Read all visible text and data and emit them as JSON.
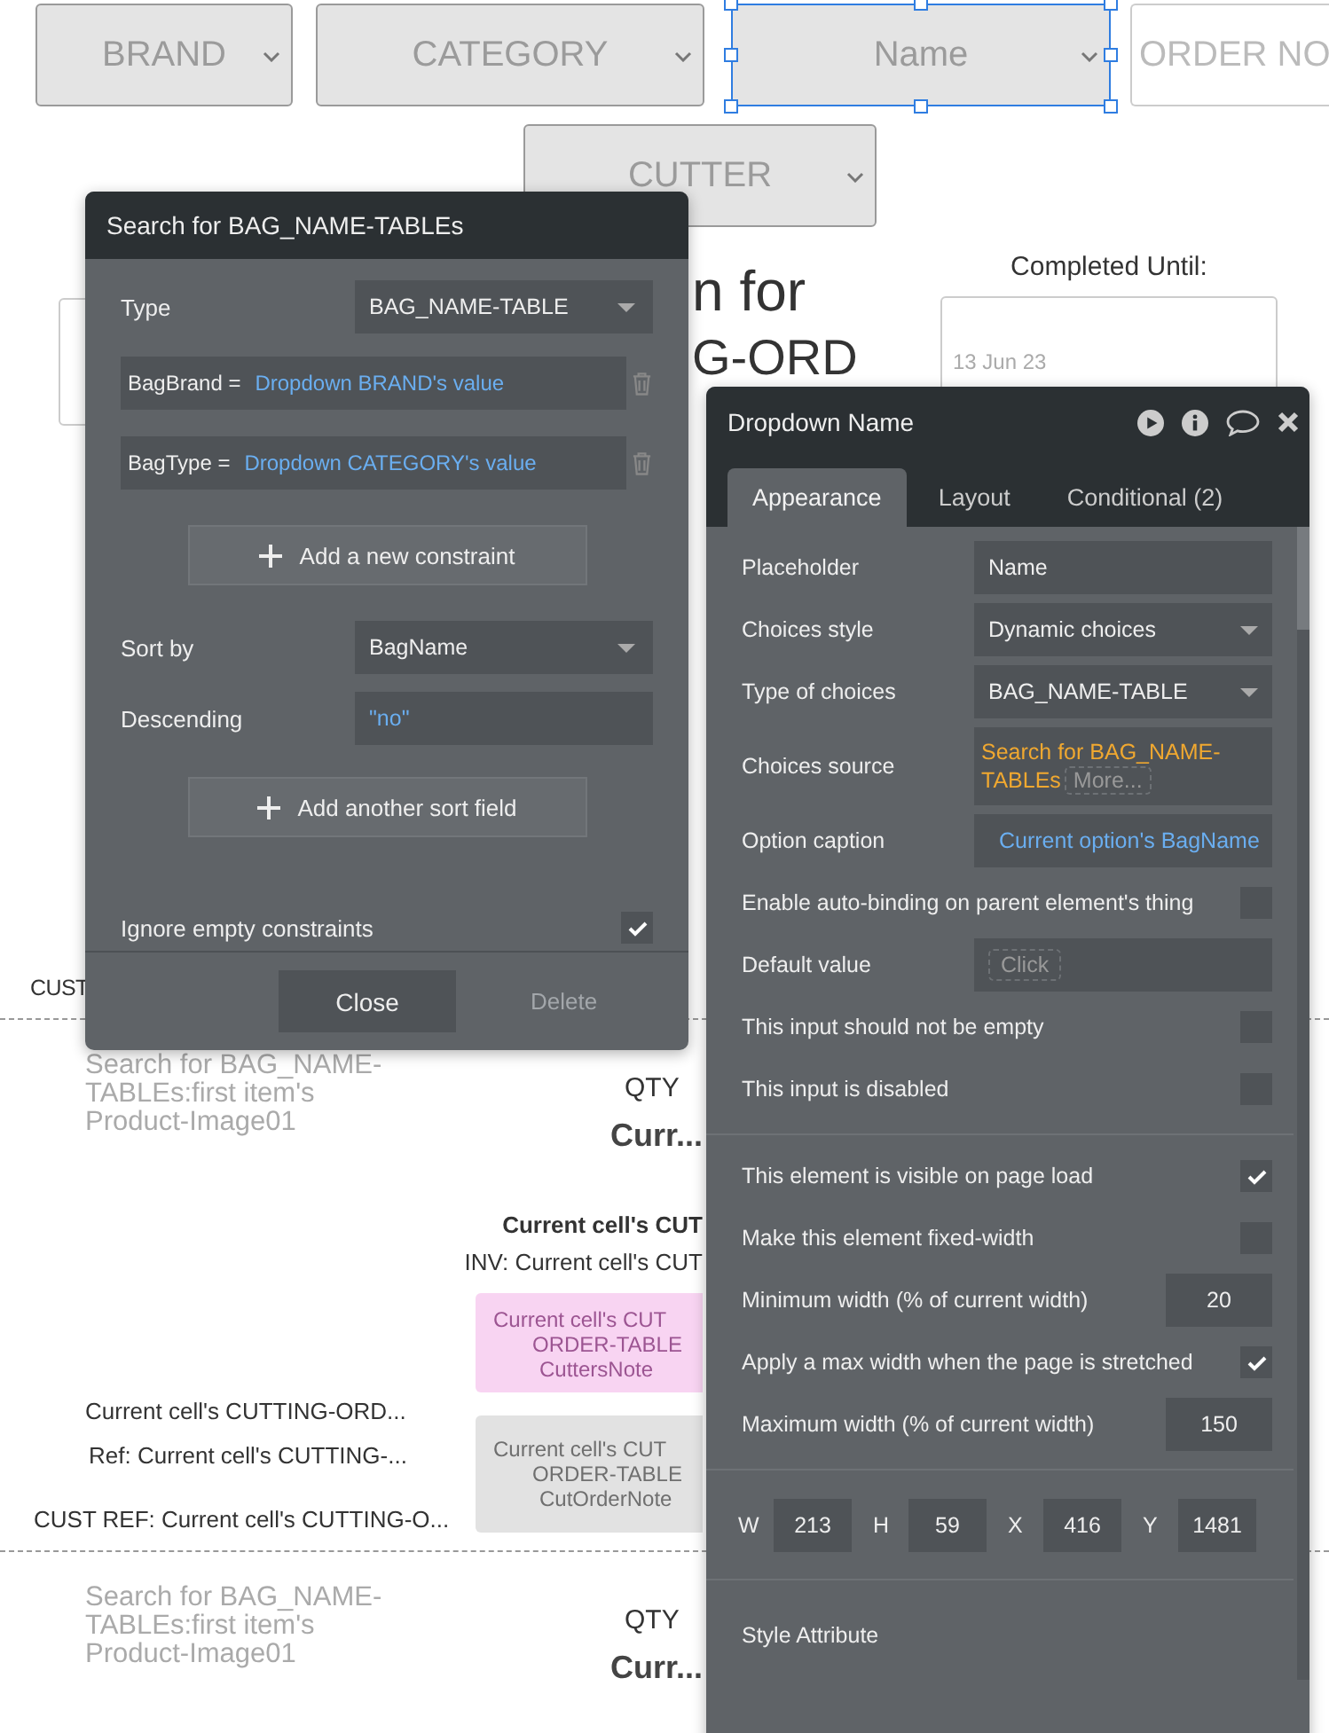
{
  "canvas": {
    "dropdowns": [
      {
        "label": "BRAND",
        "selected": false
      },
      {
        "label": "CATEGORY",
        "selected": false
      },
      {
        "label": "Name",
        "selected": true
      },
      {
        "label": "CUTTER",
        "selected": false
      }
    ],
    "order_no_field": {
      "placeholder": "ORDER NO"
    },
    "heading_fragments": [
      "n for",
      "G-ORD"
    ],
    "completed_until": {
      "label": "Completed Until:",
      "placeholder": "13 Jun 23"
    },
    "cust_label": "CUST",
    "rows": [
      {
        "image_text": "Search for BAG_NAME-TABLEs:first item's Product-Image01",
        "qty_label": "QTY",
        "qty_value": "Curr..."
      },
      {
        "image_text": "Search for BAG_NAME-TABLEs:first item's Product-Image01",
        "qty_label": "QTY",
        "qty_value": "Curr..."
      }
    ],
    "detail": {
      "title": "Current cell's CUT",
      "invoice": "INV: Current cell's CUT",
      "notes": [
        {
          "kind": "cutters",
          "lines": [
            "Current cell's CUT",
            "ORDER-TABLE",
            "CuttersNote"
          ]
        },
        {
          "kind": "order",
          "lines": [
            "Current cell's CUT",
            "ORDER-TABLE",
            "CutOrderNote"
          ]
        }
      ],
      "order_text": "Current cell's CUTTING-ORD...",
      "ref_text": "Ref: Current cell's CUTTING-...",
      "cust_ref_text": "CUST REF: Current cell's CUTTING-O..."
    }
  },
  "search_panel": {
    "title": "Search for BAG_NAME-TABLEs",
    "type_label": "Type",
    "type_value": "BAG_NAME-TABLE",
    "constraints": [
      {
        "field": "BagBrand =",
        "value": "Dropdown BRAND's value"
      },
      {
        "field": "BagType =",
        "value": "Dropdown CATEGORY's value"
      }
    ],
    "add_constraint": "Add a new constraint",
    "sort_label": "Sort by",
    "sort_value": "BagName",
    "descending_label": "Descending",
    "descending_value": "\"no\"",
    "add_sort": "Add another sort field",
    "ignore_empty": {
      "label": "Ignore empty constraints",
      "checked": true
    },
    "buttons": [
      {
        "label": "Close",
        "disabled": false
      },
      {
        "label": "Delete",
        "disabled": true
      }
    ]
  },
  "property_editor": {
    "title": "Dropdown Name",
    "tabs": [
      {
        "label": "Appearance",
        "selected": true
      },
      {
        "label": "Layout",
        "selected": false
      },
      {
        "label": "Conditional (2)",
        "selected": false
      }
    ],
    "sections": [
      [
        {
          "kind": "text",
          "label": "Placeholder",
          "value": "Name"
        },
        {
          "kind": "select",
          "label": "Choices style",
          "value": "Dynamic choices"
        },
        {
          "kind": "select",
          "label": "Type of choices",
          "value": "BAG_NAME-TABLE"
        },
        {
          "kind": "expression",
          "label": "Choices source",
          "value": "Search for BAG_NAME-TABLEs",
          "more": "More..."
        },
        {
          "kind": "dynamic",
          "label": "Option caption",
          "value": "Current option's BagName"
        },
        {
          "kind": "checkbox",
          "label": "Enable auto-binding on parent element's thing",
          "checked": false
        },
        {
          "kind": "empty",
          "label": "Default value",
          "placeholder": "Click"
        },
        {
          "kind": "checkbox",
          "label": "This input should not be empty",
          "checked": false
        },
        {
          "kind": "checkbox",
          "label": "This input is disabled",
          "checked": false
        }
      ],
      [
        {
          "kind": "checkbox",
          "label": "This element is visible on page load",
          "checked": true
        },
        {
          "kind": "checkbox",
          "label": "Make this element fixed-width",
          "checked": false
        },
        {
          "kind": "number",
          "label": "Minimum width (% of current width)",
          "value": "20"
        },
        {
          "kind": "checkbox",
          "label": "Apply a max width when the page is stretched",
          "checked": true
        },
        {
          "kind": "number",
          "label": "Maximum width (% of current width)",
          "value": "150"
        }
      ],
      [
        {
          "kind": "dims",
          "items": [
            {
              "label": "W",
              "value": "213"
            },
            {
              "label": "H",
              "value": "59"
            },
            {
              "label": "X",
              "value": "416"
            },
            {
              "label": "Y",
              "value": "1481"
            }
          ]
        }
      ],
      [
        {
          "kind": "heading",
          "label": "Style Attribute"
        }
      ]
    ]
  }
}
